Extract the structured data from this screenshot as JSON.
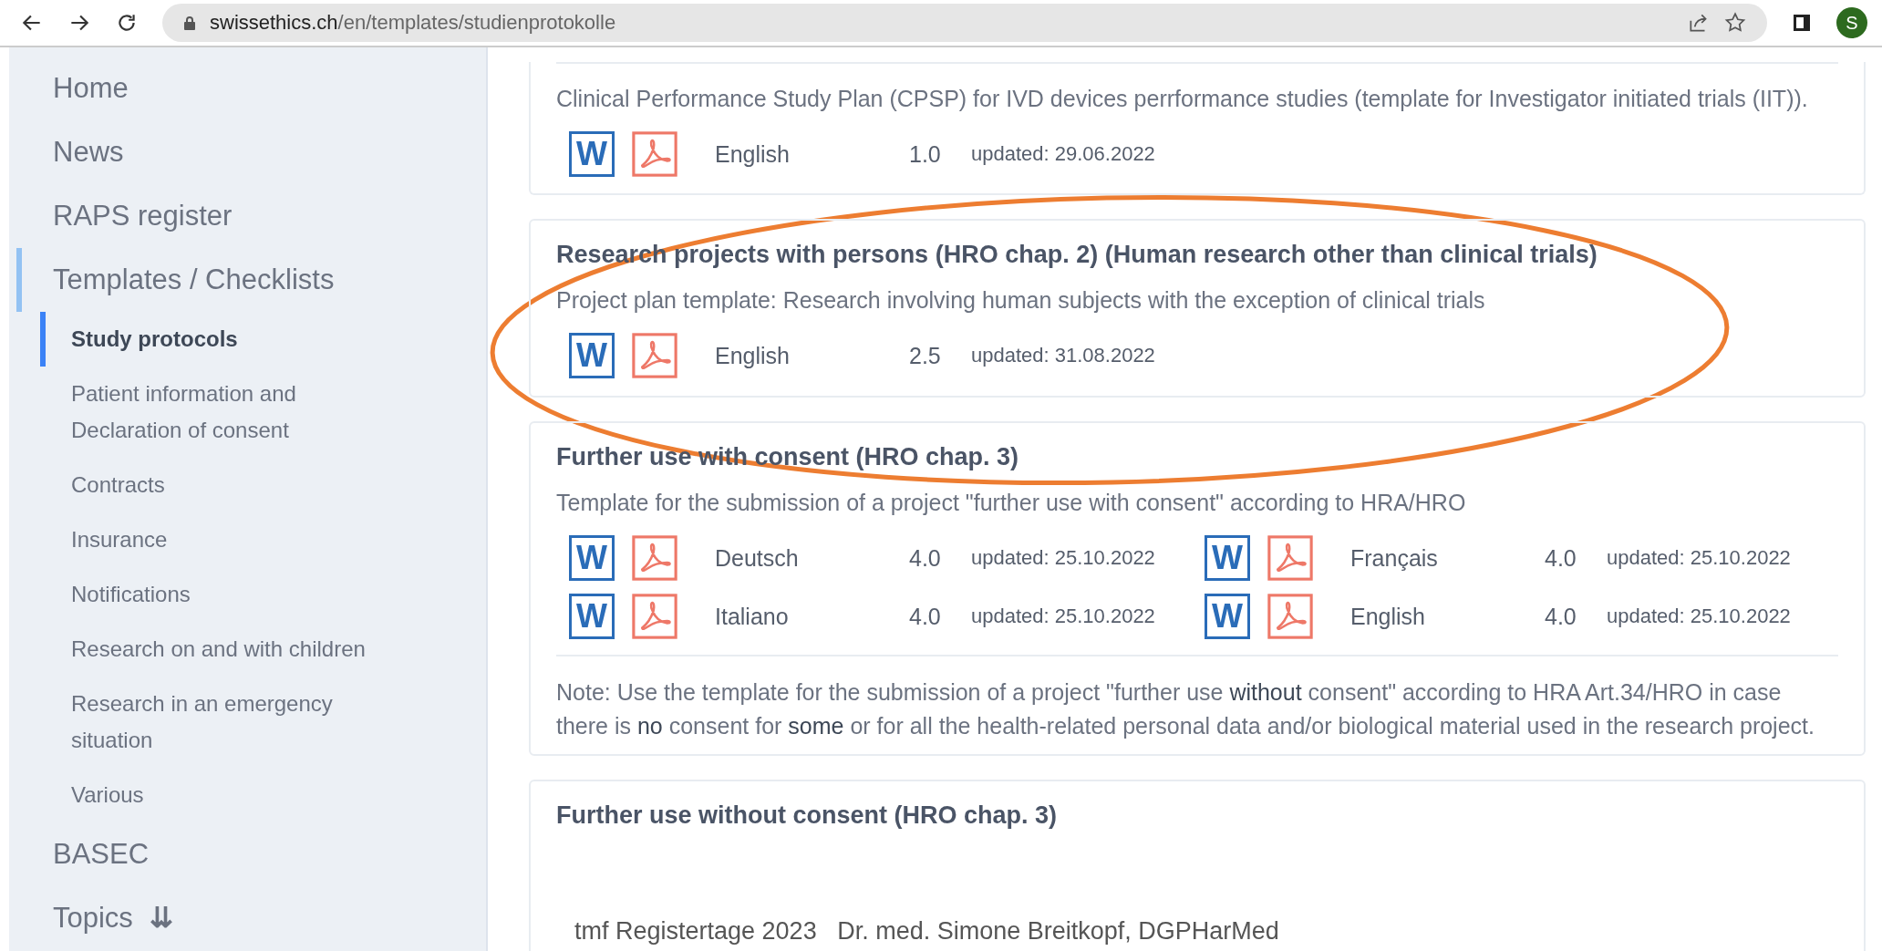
{
  "browser": {
    "url_host": "swissethics.ch",
    "url_path": "/en/templates/studienprotokolle",
    "profile_initial": "S"
  },
  "sidebar": {
    "items": [
      {
        "label": "Home",
        "selected": false
      },
      {
        "label": "News",
        "selected": false
      },
      {
        "label": "RAPS register",
        "selected": false
      },
      {
        "label": "Templates / Checklists",
        "selected": true,
        "children": [
          {
            "label": "Study protocols",
            "selected": true
          },
          {
            "label": "Patient information and Declaration of consent",
            "selected": false
          },
          {
            "label": "Contracts",
            "selected": false
          },
          {
            "label": "Insurance",
            "selected": false
          },
          {
            "label": "Notifications",
            "selected": false
          },
          {
            "label": "Research on and with children",
            "selected": false
          },
          {
            "label": "Research in an emergency situation",
            "selected": false
          },
          {
            "label": "Various",
            "selected": false
          }
        ]
      },
      {
        "label": "BASEC",
        "selected": false
      },
      {
        "label": "Topics",
        "selected": false,
        "expander": "⇊"
      }
    ]
  },
  "cards": [
    {
      "description": "Clinical Performance Study Plan (CPSP) for IVD devices perrformance studies (template for Investigator initiated trials (IIT)).",
      "files": [
        {
          "word": "W",
          "language": "English",
          "version": "1.0",
          "updated": "updated: 29.06.2022"
        }
      ]
    },
    {
      "title": "Research projects with persons (HRO chap. 2) (Human research other than clinical trials)",
      "description": "Project plan template: Research involving human subjects with the exception of clinical trials",
      "files": [
        {
          "word": "W",
          "language": "English",
          "version": "2.5",
          "updated": "updated: 31.08.2022"
        }
      ]
    },
    {
      "title": "Further use with consent (HRO chap. 3)",
      "description": "Template for the submission of a project \"further use with consent\" according to HRA/HRO",
      "files": [
        {
          "word": "W",
          "language": "Deutsch",
          "version": "4.0",
          "updated": "updated: 25.10.2022"
        },
        {
          "word": "W",
          "language": "Français",
          "version": "4.0",
          "updated": "updated: 25.10.2022"
        },
        {
          "word": "W",
          "language": "Italiano",
          "version": "4.0",
          "updated": "updated: 25.10.2022"
        },
        {
          "word": "W",
          "language": "English",
          "version": "4.0",
          "updated": "updated: 25.10.2022"
        }
      ],
      "note": "Note: Use the template for the submission of a project \"further use **without** consent\" according to HRA Art.34/HRO in case there is **no** consent for **some** or for all the health-related personal data and/or biological material used in the research project."
    },
    {
      "title": "Further use without consent (HRO chap. 3)"
    }
  ],
  "footer": "tmf Registertage 2023   Dr. med. Simone Breitkopf, DGPHarMed"
}
